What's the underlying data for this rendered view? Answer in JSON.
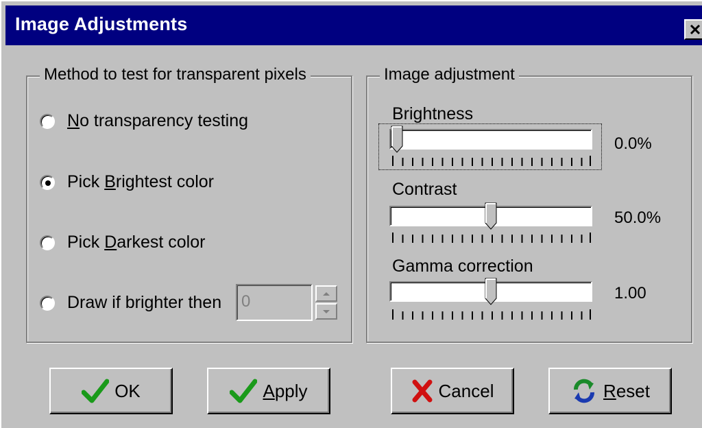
{
  "window": {
    "title": "Image Adjustments",
    "close_glyph": "X"
  },
  "method_group": {
    "title": "Method to test for transparent pixels",
    "options": [
      {
        "pre": "",
        "accel": "N",
        "post": "o transparency testing",
        "checked": false
      },
      {
        "pre": "Pick ",
        "accel": "B",
        "post": "rightest color",
        "checked": true
      },
      {
        "pre": "Pick ",
        "accel": "D",
        "post": "arkest color",
        "checked": false
      },
      {
        "pre": "Draw if brighter then",
        "accel": "",
        "post": "",
        "checked": false
      }
    ],
    "threshold_value": "0"
  },
  "adjust_group": {
    "title": "Image adjustment",
    "brightness": {
      "label": "Brightness",
      "value_text": "0.0%",
      "level": 0.0
    },
    "contrast": {
      "label": "Contrast",
      "value_text": "50.0%",
      "level": 0.5
    },
    "gamma": {
      "label": "Gamma correction",
      "value_text": "1.00",
      "level": 0.5
    }
  },
  "buttons": {
    "ok": {
      "label": "OK",
      "icon": "checkmark-icon",
      "accel": "",
      "rest": "OK"
    },
    "apply": {
      "accel": "A",
      "rest": "pply",
      "icon": "checkmark-icon"
    },
    "cancel": {
      "label": "Cancel",
      "icon": "red-x-icon"
    },
    "reset": {
      "accel": "R",
      "rest": "eset",
      "icon": "refresh-icon"
    }
  },
  "colors": {
    "titlebar": "#000080",
    "face": "#c0c0c0",
    "check_green": "#1a9a1a",
    "cancel_red": "#d01010",
    "reset_green": "#1a8a2a",
    "reset_blue": "#1a3ab0"
  }
}
